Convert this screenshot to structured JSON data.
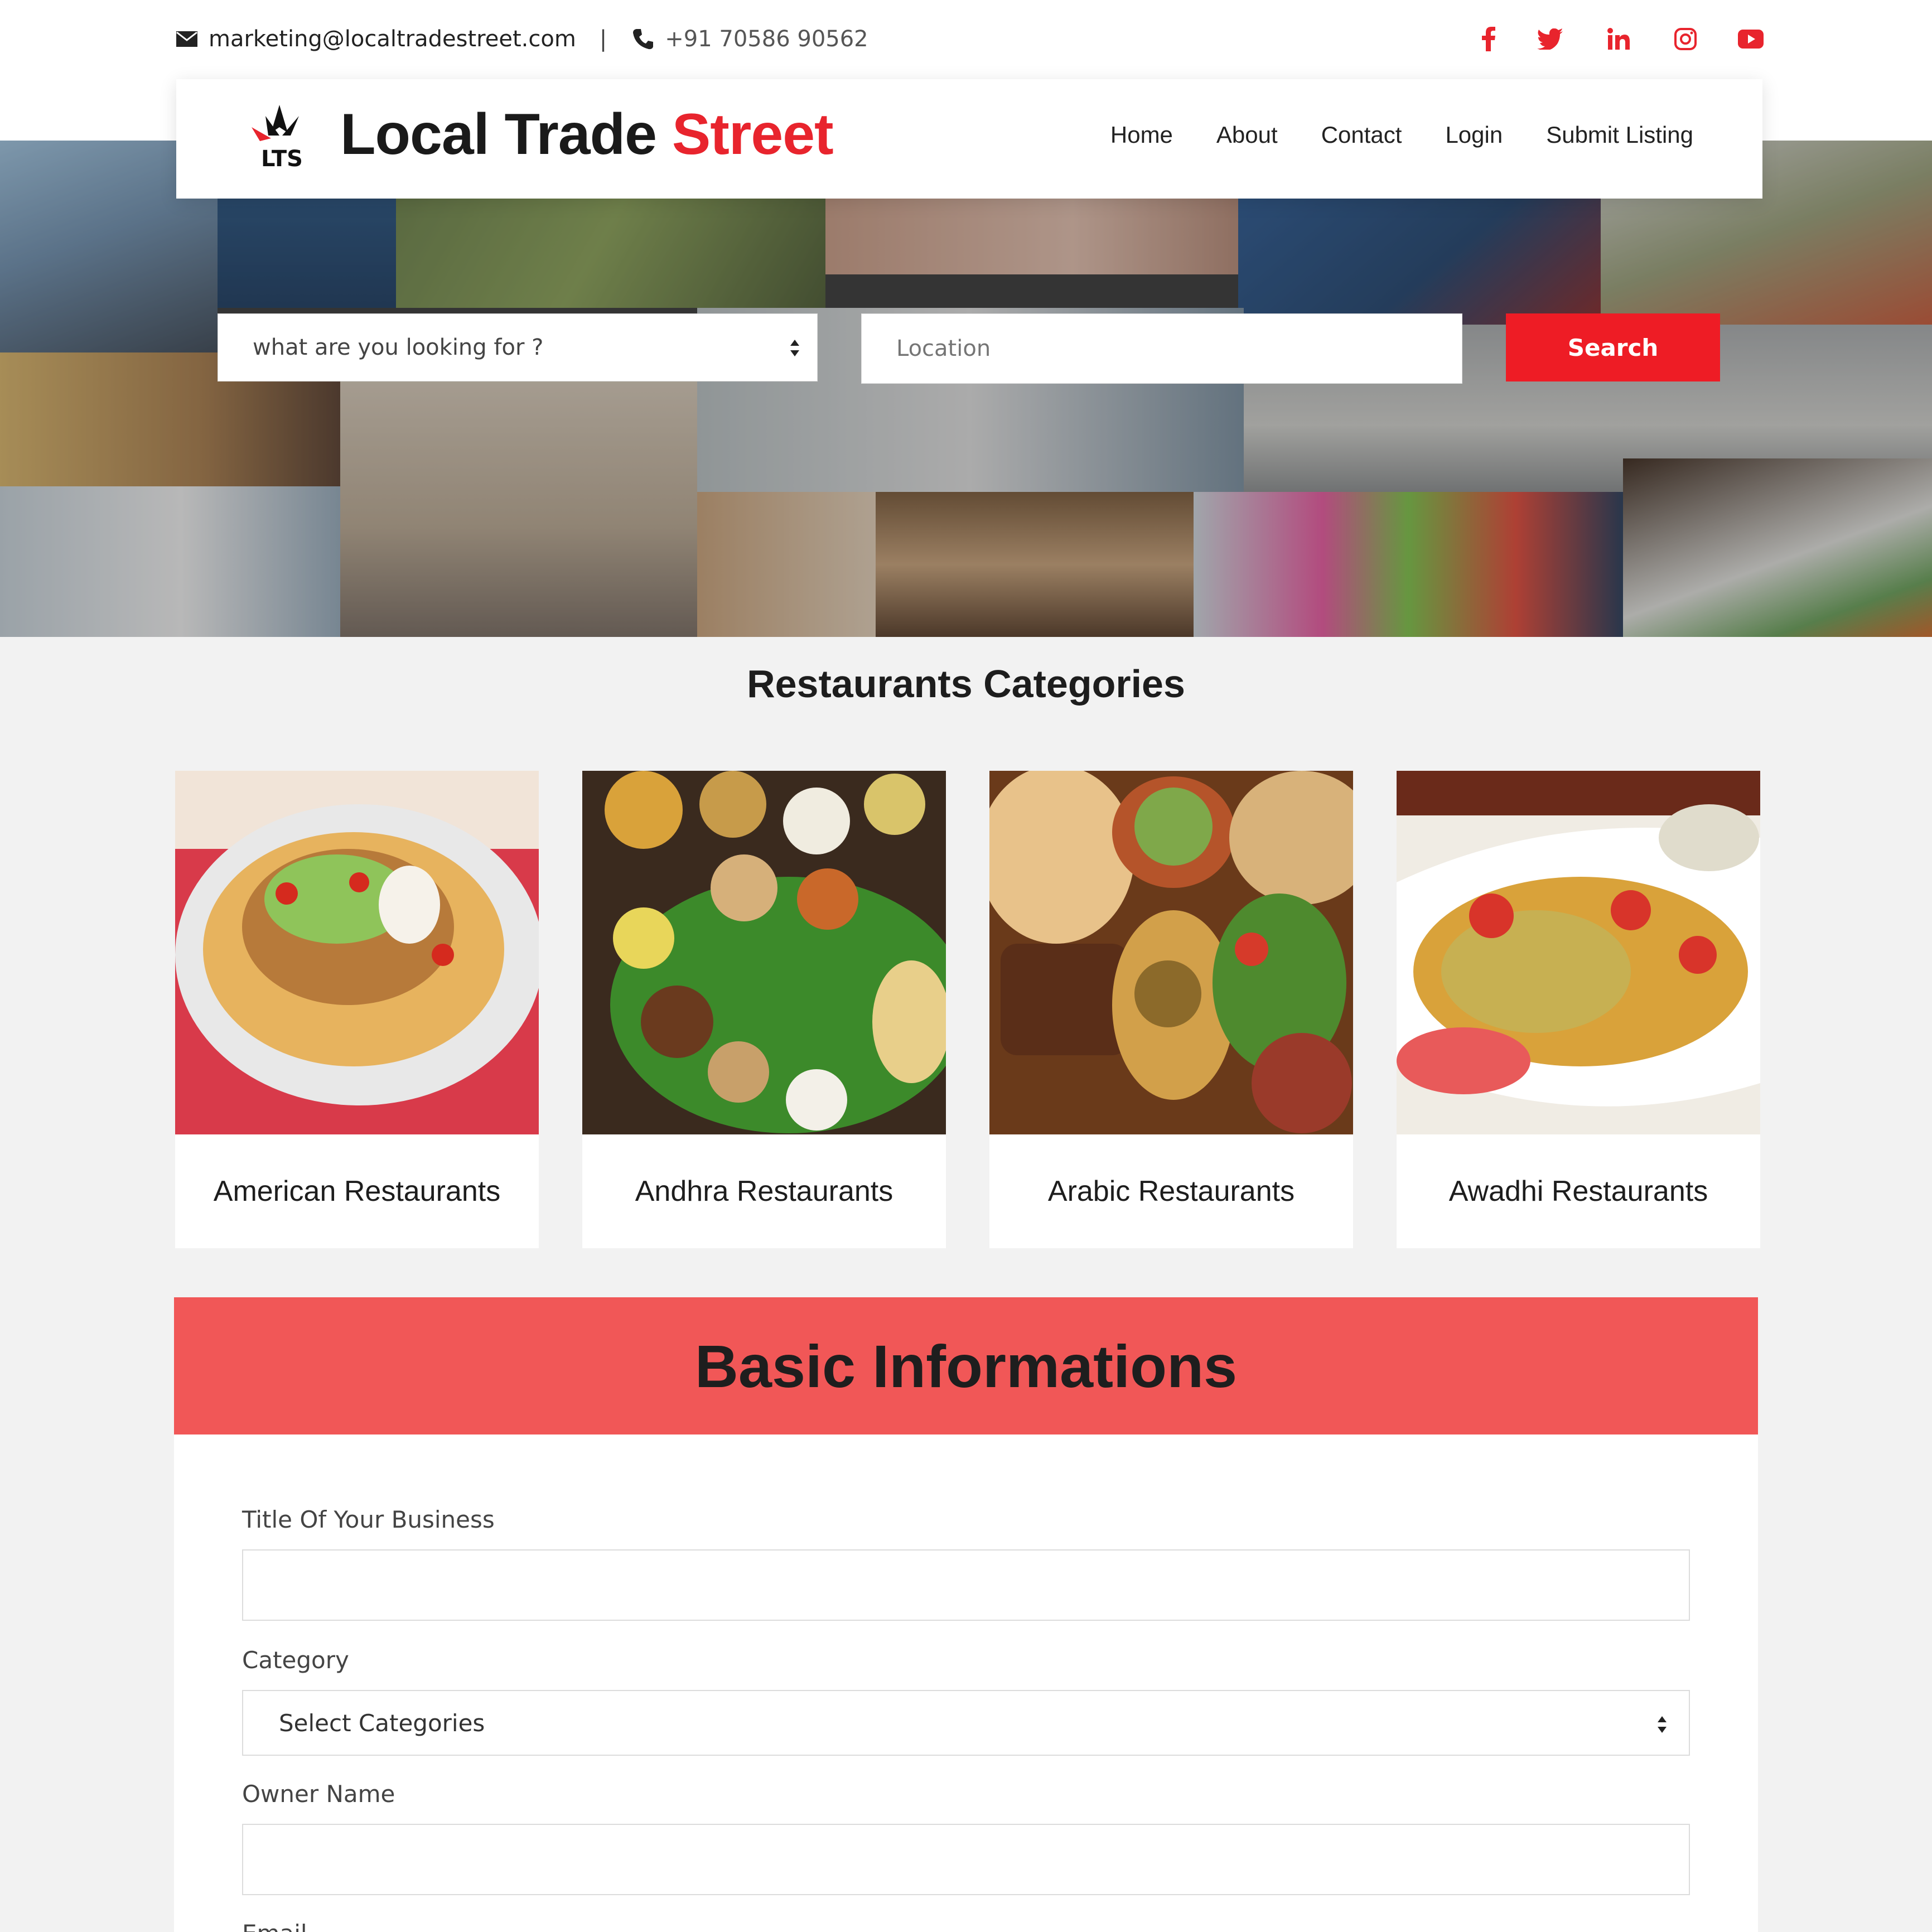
{
  "topbar": {
    "email": "marketing@localtradestreet.com",
    "separator": "|",
    "phone": "+91 70586 90562",
    "social": [
      "facebook-icon",
      "twitter-icon",
      "linkedin-icon",
      "instagram-icon",
      "youtube-icon"
    ]
  },
  "header": {
    "logo_text": "LTS",
    "brand_part1": "Local Trade ",
    "brand_part2": "Street",
    "nav": [
      "Home",
      "About",
      "Contact",
      "Login",
      "Submit Listing"
    ]
  },
  "search": {
    "what_placeholder": "what are you looking for ?",
    "location_placeholder": "Location",
    "button_label": "Search"
  },
  "categories": {
    "title": "Restaurants Categories",
    "items": [
      {
        "label": "American Restaurants"
      },
      {
        "label": "Andhra Restaurants"
      },
      {
        "label": "Arabic Restaurants"
      },
      {
        "label": "Awadhi Restaurants"
      }
    ]
  },
  "form": {
    "title": "Basic Informations",
    "fields": {
      "business_title_label": "Title Of Your Business",
      "category_label": "Category",
      "category_value": "Select Categories",
      "owner_label": "Owner Name",
      "email_label": "Email"
    }
  },
  "colors": {
    "accent": "#ee1c25",
    "banner": "#f15757",
    "page_bg": "#f2f2f2"
  }
}
